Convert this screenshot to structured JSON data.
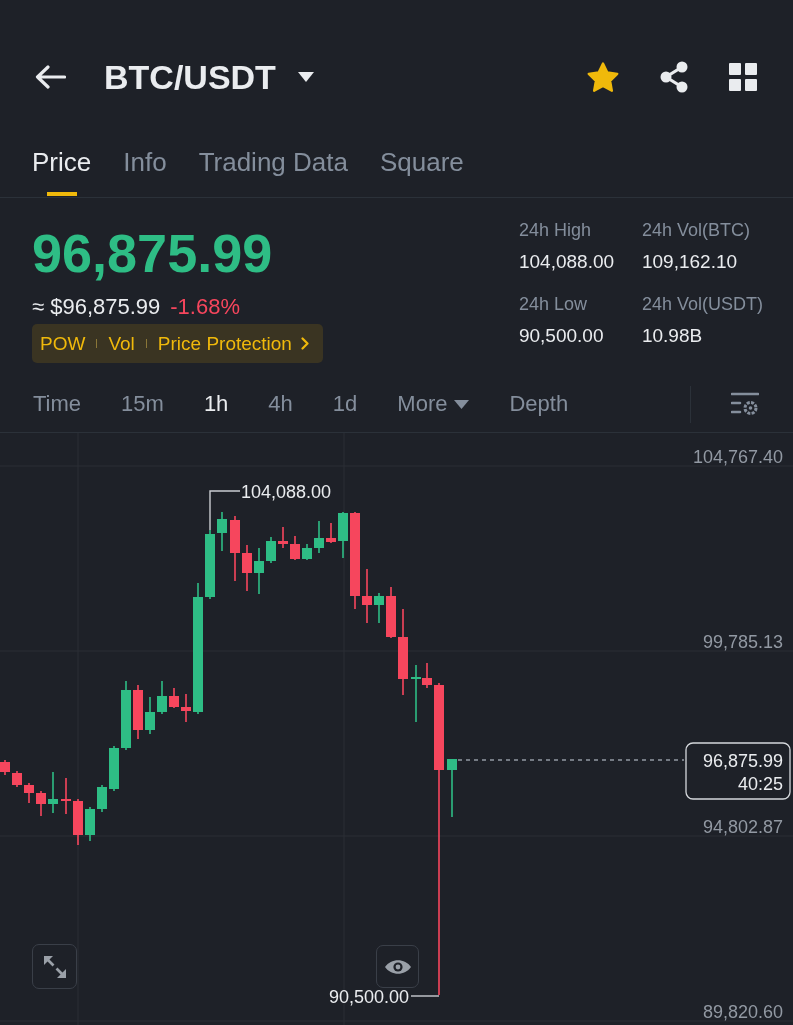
{
  "header": {
    "title": "BTC/USDT",
    "favorited": true
  },
  "tabs": [
    {
      "label": "Price",
      "selected": true
    },
    {
      "label": "Info",
      "selected": false
    },
    {
      "label": "Trading Data",
      "selected": false
    },
    {
      "label": "Square",
      "selected": false
    }
  ],
  "ticker": {
    "last_price": "96,875.99",
    "fiat_price": "≈ $96,875.99",
    "change": "-1.68%",
    "tags": [
      {
        "label": "POW",
        "kind": "tag"
      },
      {
        "label": "Vol",
        "kind": "tag"
      },
      {
        "label": "Price Protection",
        "kind": "link"
      }
    ],
    "stats": [
      {
        "label": "24h High",
        "value": "104,088.00"
      },
      {
        "label": "24h Vol(BTC)",
        "value": "109,162.10"
      },
      {
        "label": "24h Low",
        "value": "90,500.00"
      },
      {
        "label": "24h Vol(USDT)",
        "value": "10.98B"
      }
    ]
  },
  "intervals": [
    {
      "label": "Time",
      "kind": "option",
      "selected": false
    },
    {
      "label": "15m",
      "kind": "option",
      "selected": false
    },
    {
      "label": "1h",
      "kind": "option",
      "selected": true
    },
    {
      "label": "4h",
      "kind": "option",
      "selected": false
    },
    {
      "label": "1d",
      "kind": "option",
      "selected": false
    },
    {
      "label": "More",
      "kind": "dropdown",
      "selected": false
    },
    {
      "label": "Depth",
      "kind": "option",
      "selected": false
    }
  ],
  "chart": {
    "price_axis": [
      "104,767.40",
      "99,785.13",
      "94,802.87",
      "89,820.60"
    ],
    "high_marker": "104,088.00",
    "low_marker": "90,500.00",
    "last_price": "96,875.99",
    "countdown": "40:25"
  }
}
